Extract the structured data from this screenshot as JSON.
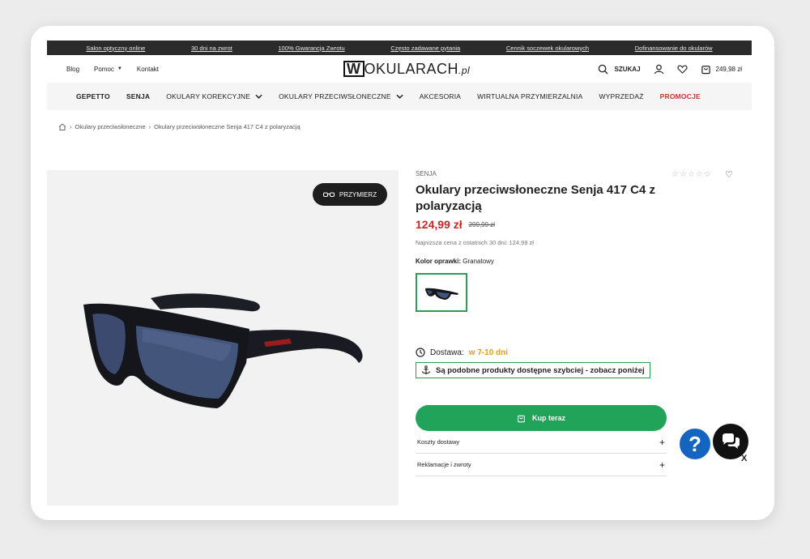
{
  "topbar": {
    "links": [
      "Salon optyczny online",
      "30 dni na zwrot",
      "100% Gwarancja Zwrotu",
      "Często zadawane pytania",
      "Cennik soczewek okularowych",
      "Dofinansowanie do okularów"
    ]
  },
  "header": {
    "left_links": [
      "Blog",
      "Pomoc",
      "Kontakt"
    ],
    "logo_main": "OKULARACH",
    "logo_w": "W",
    "logo_tld": ".pl",
    "search_label": "SZUKAJ",
    "cart_total": "249,98 zł"
  },
  "nav": {
    "items": [
      "GEPETTO",
      "SENJA",
      "OKULARY KOREKCYJNE",
      "OKULARY PRZECIWSŁONECZNE",
      "AKCESORIA",
      "WIRTUALNA PRZYMIERZALNIA",
      "WYPRZEDAŻ",
      "PROMOCJE"
    ]
  },
  "breadcrumb": {
    "items": [
      "Okulary przeciwsłoneczne",
      "Okulary przeciwsłoneczne Senja 417 C4 z polaryzacją"
    ]
  },
  "gallery": {
    "tryon_label": "PRZYMIERZ"
  },
  "product": {
    "brand": "SENJA",
    "title": "Okulary przeciwsłoneczne Senja 417 C4 z polaryzacją",
    "price": "124,99 zł",
    "old_price": "299,99 zł",
    "lowest_price": "Najniższa cena z ostatnich 30 dni: 124,99 zł",
    "color_label": "Kolor oprawki:",
    "color_value": "Granatowy",
    "delivery_label": "Dostawa:",
    "delivery_value": "w 7-10 dni",
    "similar_text": "Są podobne produkty dostępne szybciej - zobacz poniżej",
    "buy_label": "Kup teraz",
    "accordion": [
      "Koszty dostawy",
      "Reklamacje i zwroty"
    ]
  },
  "widgets": {
    "help_symbol": "?",
    "close_symbol": "X"
  },
  "colors": {
    "accent_green": "#21a35a",
    "price_red": "#c62828",
    "delivery_orange": "#e0a010",
    "topbar_bg": "#2b2b2b",
    "help_blue": "#1565c0"
  }
}
